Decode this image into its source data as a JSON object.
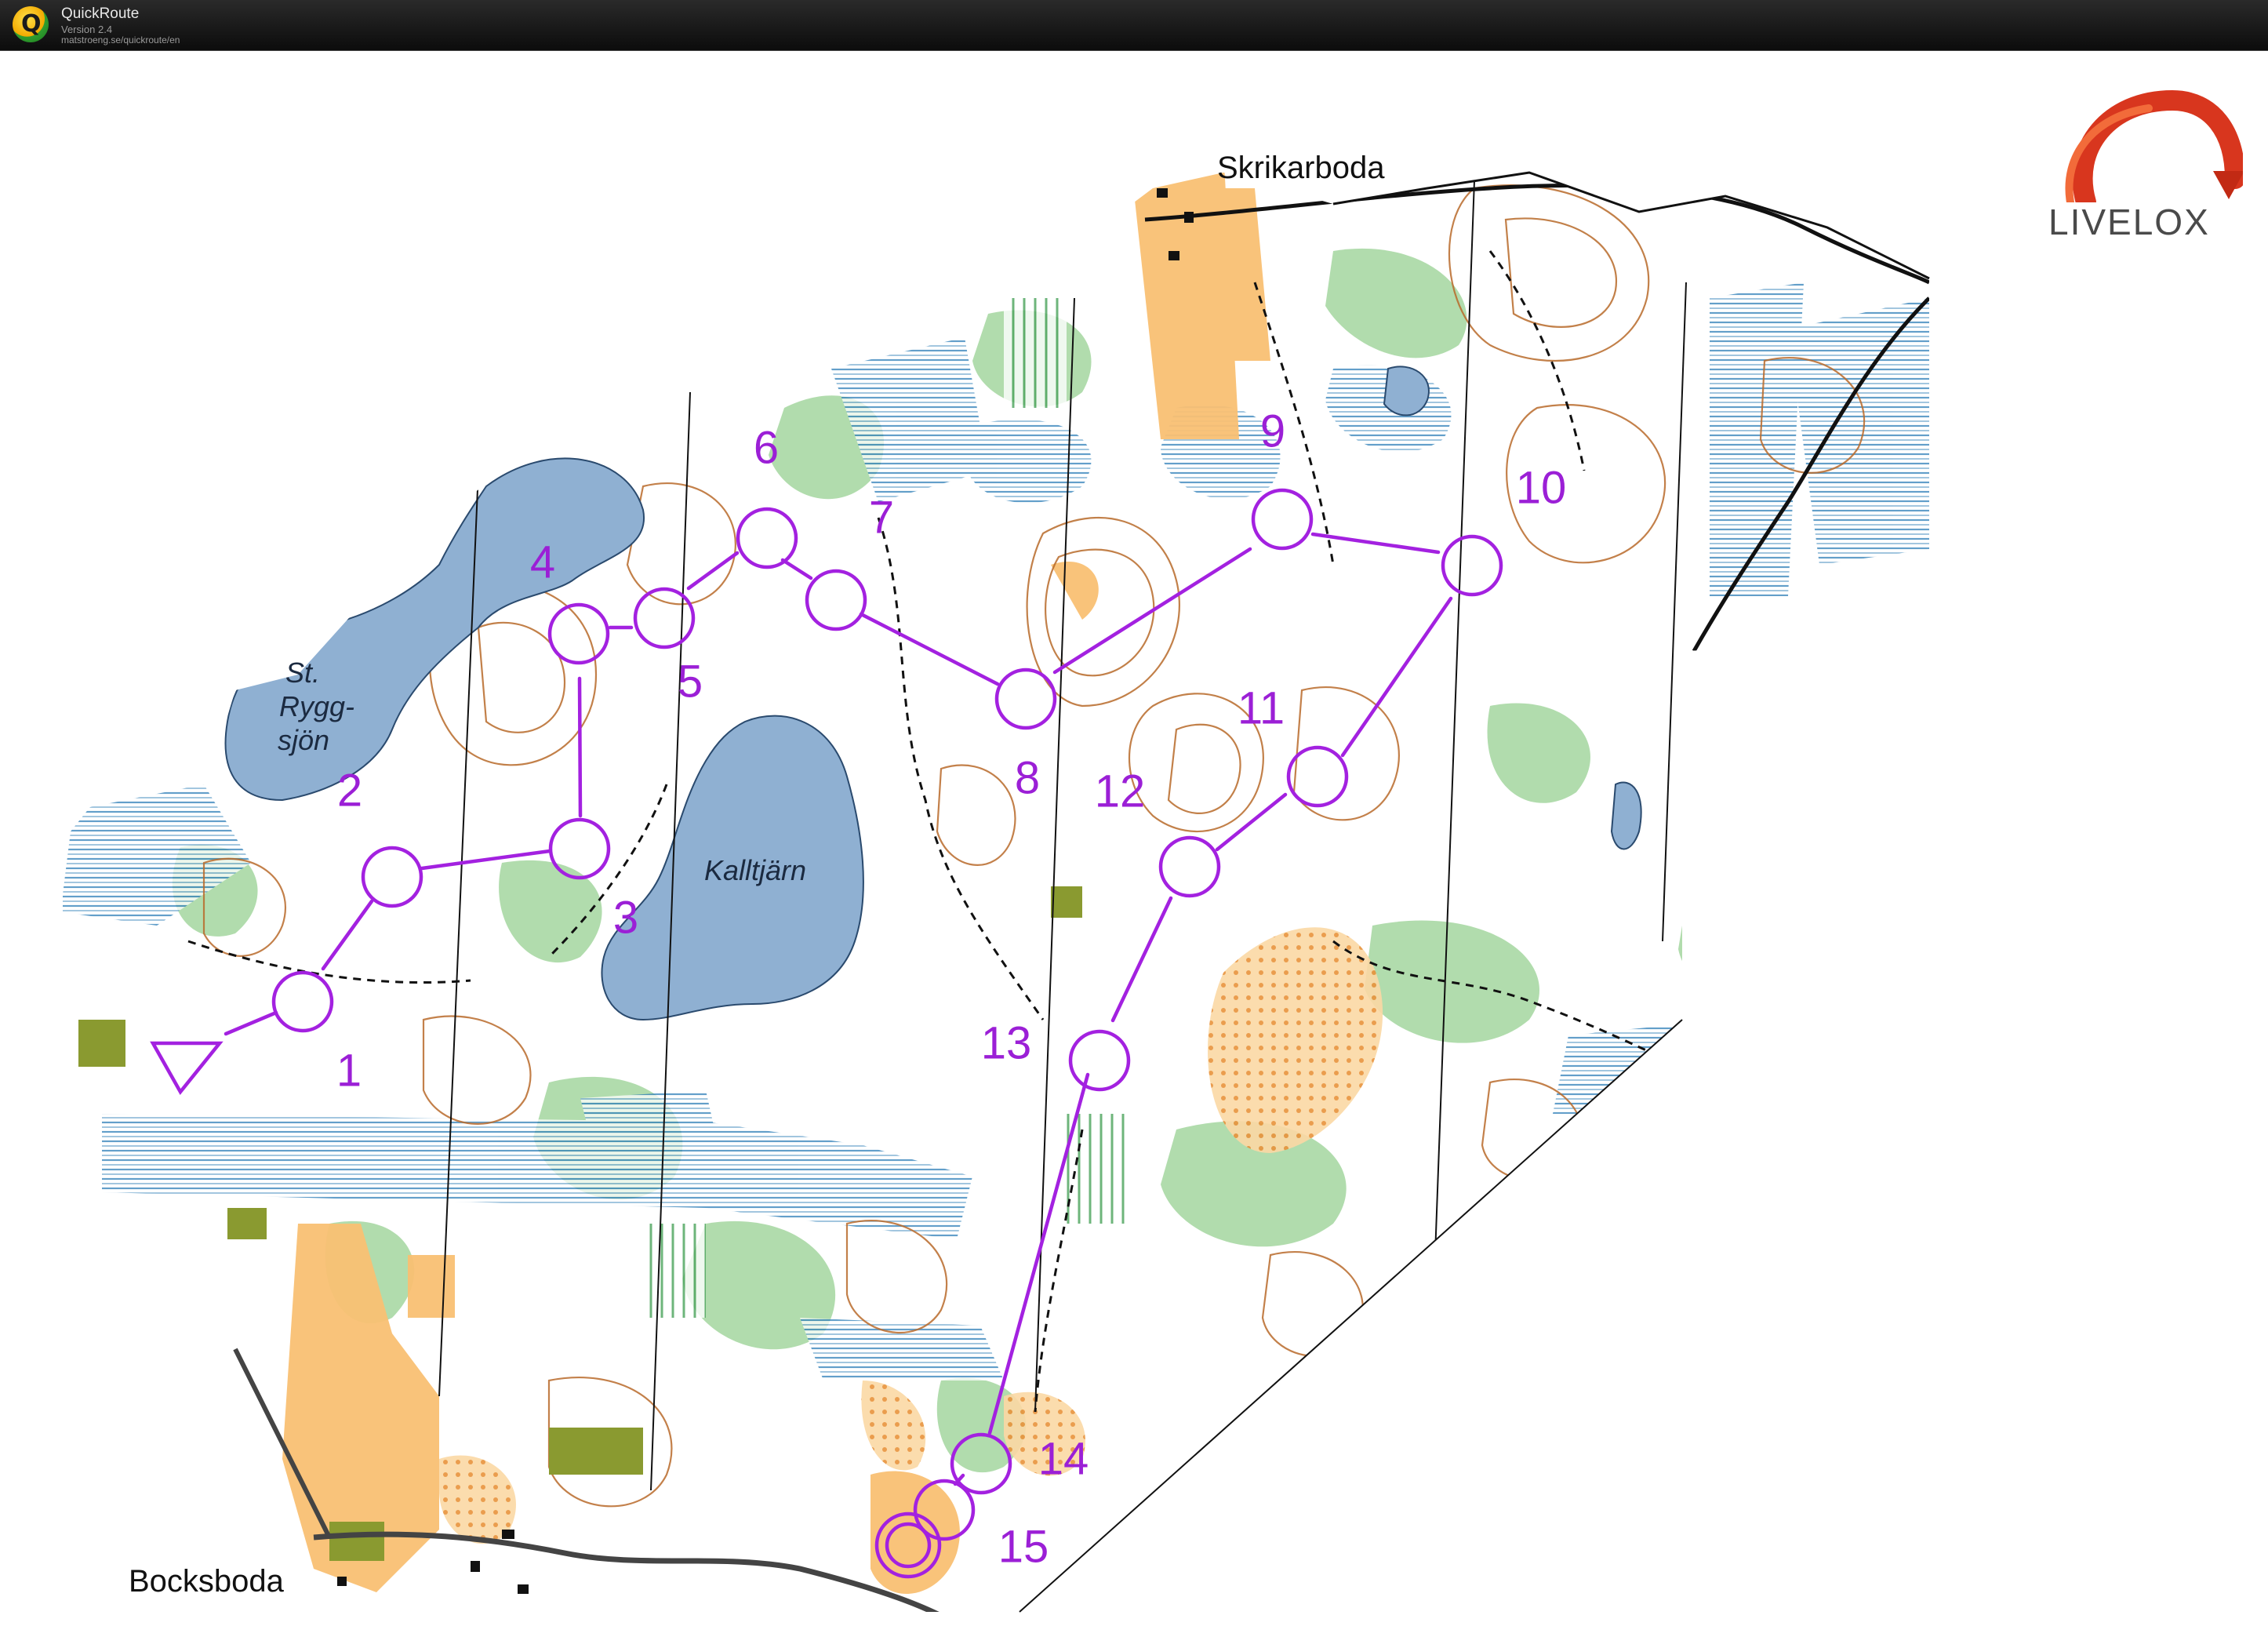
{
  "window": {
    "app_name": "QuickRoute",
    "version": "Version 2.4",
    "url": "matstroeng.se/quickroute/en"
  },
  "brand": {
    "name": "LIVELOX"
  },
  "colors": {
    "course": "#a321e0",
    "lake": "#8fb0d2",
    "marsh": "#2f7fb8",
    "forest_green": "#62b26a",
    "open_land": "#f7b35e",
    "contour": "#b86a2a",
    "settlement": "#8a9a30"
  },
  "places": {
    "north": "Skrikarboda",
    "southwest": "Bocksboda"
  },
  "lakes": {
    "ryggsjon": [
      "St.",
      "Rygg-",
      "sjön"
    ],
    "kalltjarn": "Kalltjärn"
  },
  "course": {
    "controls": [
      {
        "label": "1"
      },
      {
        "label": "2"
      },
      {
        "label": "3"
      },
      {
        "label": "4"
      },
      {
        "label": "5"
      },
      {
        "label": "6"
      },
      {
        "label": "7"
      },
      {
        "label": "8"
      },
      {
        "label": "9"
      },
      {
        "label": "10"
      },
      {
        "label": "11"
      },
      {
        "label": "12"
      },
      {
        "label": "13"
      },
      {
        "label": "14"
      },
      {
        "label": "15"
      }
    ]
  }
}
